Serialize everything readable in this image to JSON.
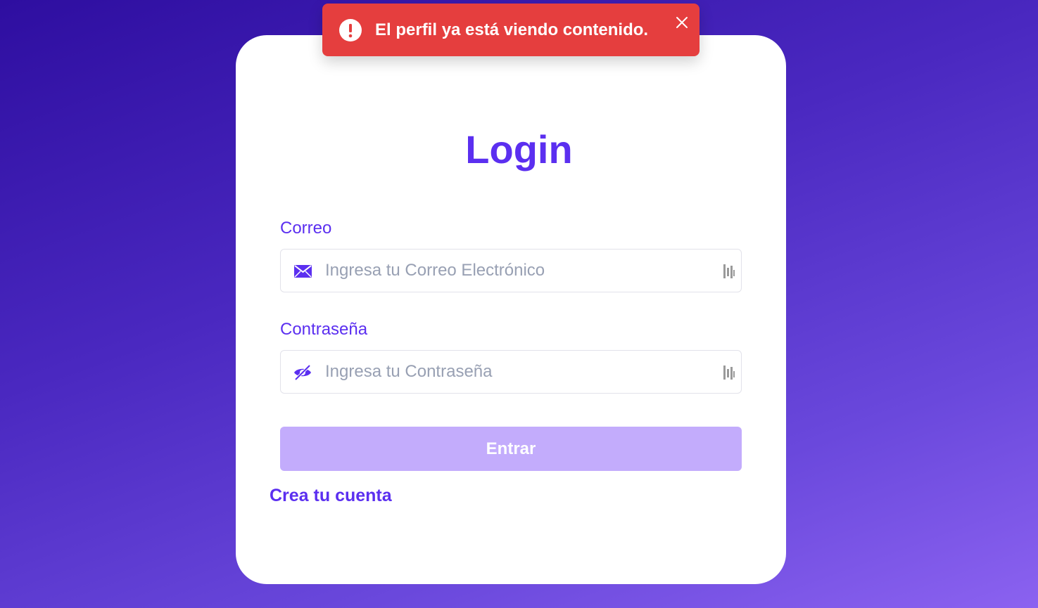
{
  "toast": {
    "message": "El perfil ya está viendo contenido.",
    "icon": "alert-circle-icon",
    "close_icon": "close-icon",
    "color": "#e53e3e"
  },
  "login": {
    "title": "Login",
    "email_label": "Correo",
    "email_placeholder": "Ingresa tu Correo Electrónico",
    "email_value": "",
    "email_icon": "mail-icon",
    "password_label": "Contraseña",
    "password_placeholder": "Ingresa tu Contraseña",
    "password_value": "",
    "password_icon": "eye-off-icon",
    "submit_label": "Entrar",
    "create_account_label": "Crea tu cuenta"
  },
  "colors": {
    "accent": "#5b2ff0",
    "button_disabled": "#c3acfc"
  }
}
